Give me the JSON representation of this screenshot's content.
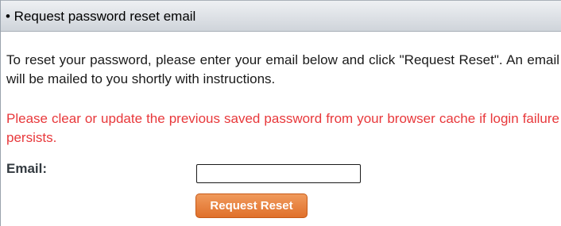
{
  "panel": {
    "title": "• Request password reset email"
  },
  "instructions": "To reset your password, please enter your email below and click \"Request Reset\". An email will be mailed to you shortly with instructions.",
  "warning": "Please clear or update the previous saved password from your browser cache if login failure persists.",
  "form": {
    "email_label": "Email:",
    "email_value": "",
    "email_placeholder": "",
    "submit_label": "Request Reset"
  },
  "colors": {
    "warning_text": "#e8383b",
    "button_top": "#f09a5c",
    "button_bottom": "#e0702b",
    "header_top": "#eef0f3",
    "header_bottom": "#cfd4da"
  }
}
